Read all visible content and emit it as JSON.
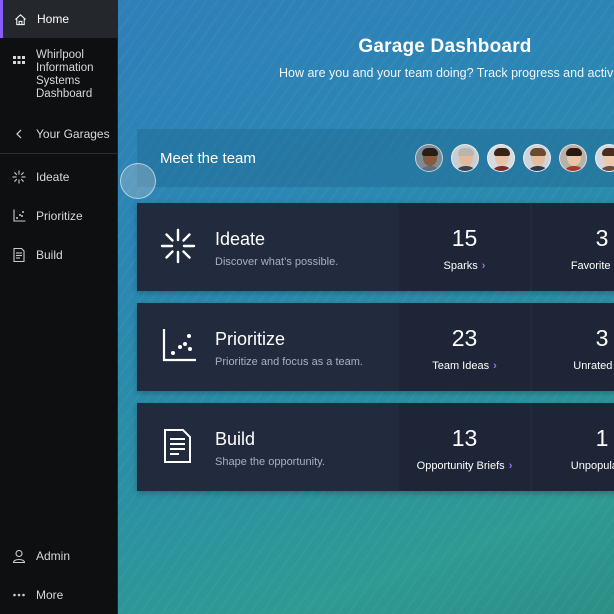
{
  "sidebar": {
    "home": {
      "label": "Home",
      "icon": "home-icon"
    },
    "system": {
      "lines": [
        "Whirlpool",
        "Information",
        "Systems",
        "Dashboard"
      ],
      "icon": "grid-icon"
    },
    "garages": {
      "label": "Your Garages",
      "icon": "chevron-left-icon"
    },
    "items": [
      {
        "label": "Ideate",
        "icon": "sparkle-icon"
      },
      {
        "label": "Prioritize",
        "icon": "scatter-icon"
      },
      {
        "label": "Build",
        "icon": "document-icon"
      }
    ],
    "admin": {
      "label": "Admin",
      "icon": "user-icon"
    },
    "more": {
      "label": "More",
      "icon": "more-icon"
    }
  },
  "header": {
    "title": "Garage Dashboard",
    "subtitle": "How are you and your team doing? Track progress and activ"
  },
  "team": {
    "title": "Meet the team",
    "members": 6
  },
  "cards": [
    {
      "title": "Ideate",
      "desc": "Discover what’s possible.",
      "icon": "sparkle-icon",
      "stats": [
        {
          "value": "15",
          "label": "Sparks"
        },
        {
          "value": "3",
          "label": "Favorite Spa"
        }
      ]
    },
    {
      "title": "Prioritize",
      "desc": "Prioritize and focus as a team.",
      "icon": "scatter-icon",
      "stats": [
        {
          "value": "23",
          "label": "Team Ideas"
        },
        {
          "value": "3",
          "label": "Unrated Ide"
        }
      ]
    },
    {
      "title": "Build",
      "desc": "Shape the opportunity.",
      "icon": "document-icon",
      "stats": [
        {
          "value": "13",
          "label": "Opportunity Briefs"
        },
        {
          "value": "1",
          "label": "Unpopulated"
        }
      ]
    }
  ],
  "colors": {
    "accent": "#8a5cf6",
    "chevron": "#a36cf2",
    "card_bg": "#222b3e",
    "sidebar_bg": "#0e0f11"
  }
}
